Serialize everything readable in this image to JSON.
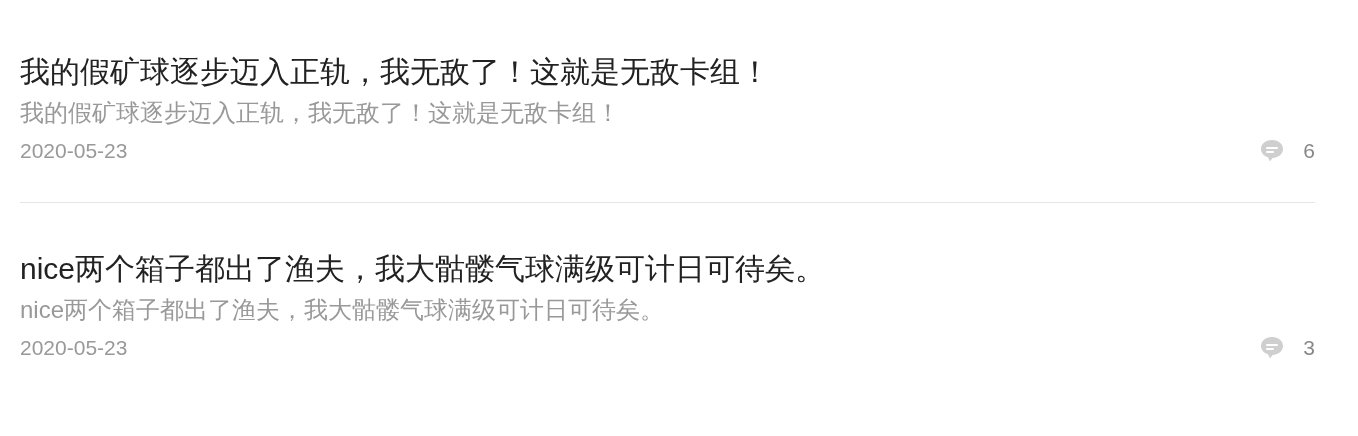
{
  "posts": [
    {
      "title": "我的假矿球逐步迈入正轨，我无敌了！这就是无敌卡组！",
      "summary": "我的假矿球逐步迈入正轨，我无敌了！这就是无敌卡组！",
      "date": "2020-05-23",
      "comment_count": "6"
    },
    {
      "title": "nice两个箱子都出了渔夫，我大骷髅气球满级可计日可待矣。",
      "summary": "nice两个箱子都出了渔夫，我大骷髅气球满级可计日可待矣。",
      "date": "2020-05-23",
      "comment_count": "3"
    }
  ]
}
